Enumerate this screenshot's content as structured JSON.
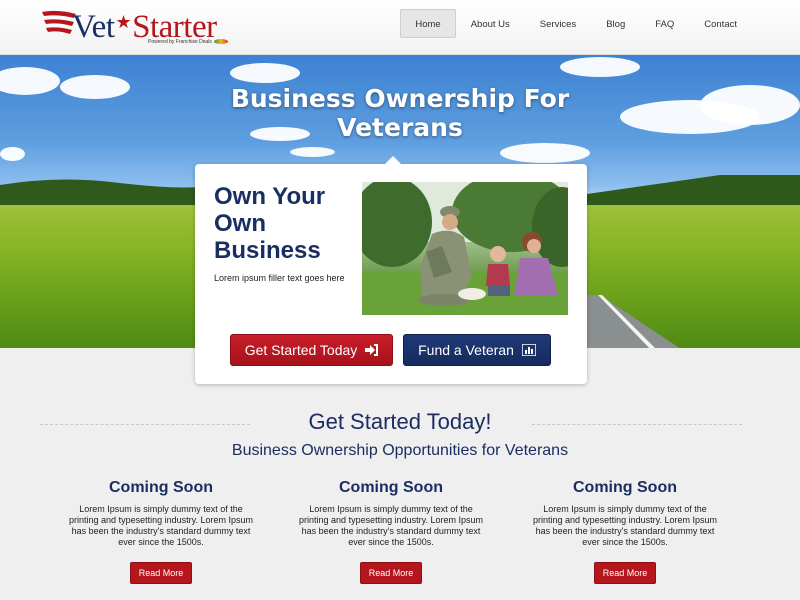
{
  "logo": {
    "text_part1": "Vet",
    "text_part2": "Starter",
    "tagline": "Powered by Franchise Deals",
    "brand_blue": "#1b2e63",
    "brand_red": "#b5161c"
  },
  "nav": {
    "items": [
      {
        "label": "Home",
        "active": true
      },
      {
        "label": "About Us",
        "active": false
      },
      {
        "label": "Services",
        "active": false
      },
      {
        "label": "Blog",
        "active": false
      },
      {
        "label": "FAQ",
        "active": false
      },
      {
        "label": "Contact",
        "active": false
      }
    ]
  },
  "hero": {
    "title_line1": "Business Ownership For",
    "title_line2": "Veterans"
  },
  "card": {
    "heading": "Own Your Own Business",
    "text": "Lorem ipsum filler text goes here",
    "photo_icon": "veteran-family-photo",
    "primary_button": {
      "label": "Get Started Today",
      "icon": "sign-in-icon"
    },
    "secondary_button": {
      "label": "Fund a Veteran",
      "icon": "bar-chart-icon"
    }
  },
  "section": {
    "title": "Get Started Today!",
    "subtitle": "Business Ownership Opportunities for Veterans",
    "columns": [
      {
        "title": "Coming Soon",
        "text": "Lorem Ipsum is simply dummy text of the printing and typesetting industry. Lorem Ipsum has been the industry's standard dummy text ever since the 1500s.",
        "button": "Read More"
      },
      {
        "title": "Coming Soon",
        "text": "Lorem Ipsum is simply dummy text of the printing and typesetting industry. Lorem Ipsum has been the industry's standard dummy text ever since the 1500s.",
        "button": "Read More"
      },
      {
        "title": "Coming Soon",
        "text": "Lorem Ipsum is simply dummy text of the printing and typesetting industry. Lorem Ipsum has been the industry's standard dummy text ever since the 1500s.",
        "button": "Read More"
      }
    ]
  }
}
